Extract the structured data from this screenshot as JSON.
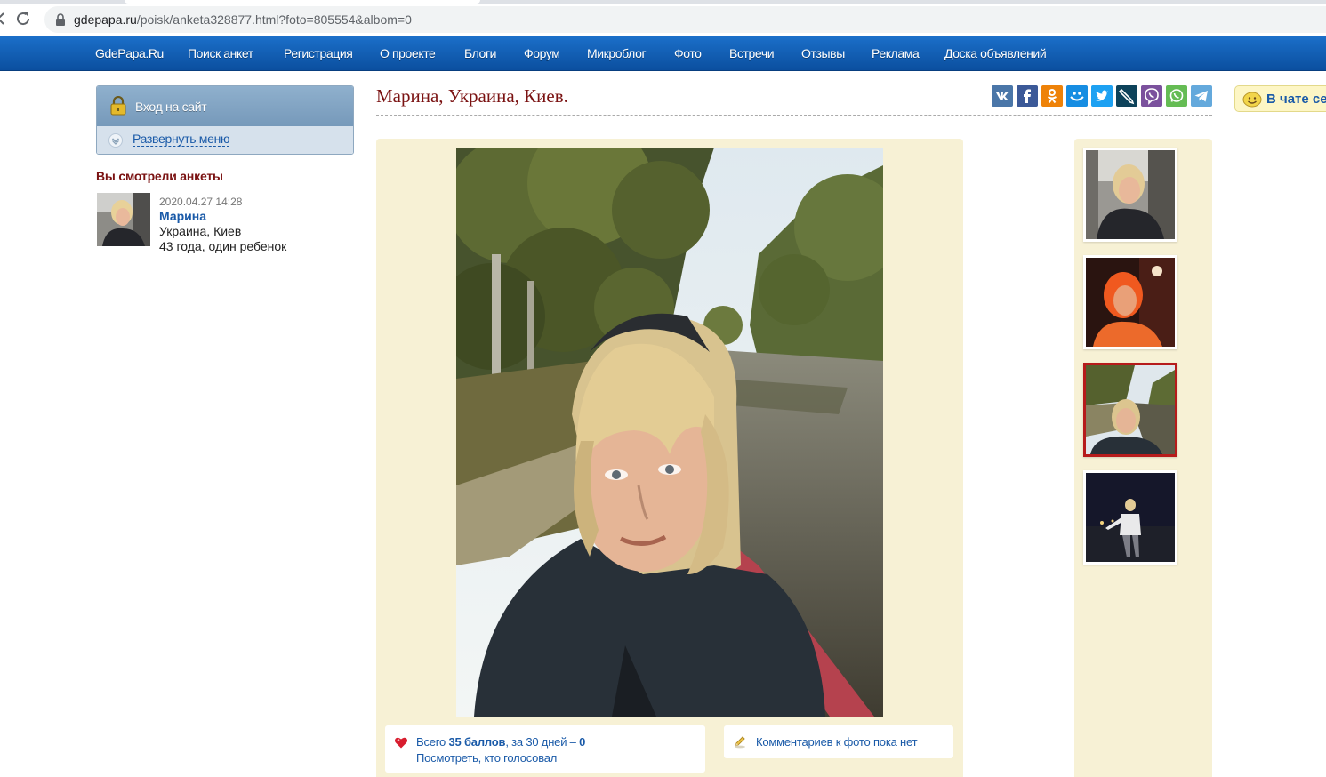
{
  "browser": {
    "url_host": "gdepapa.ru",
    "url_path": "/poisk/anketa328877.html?foto=805554&albom=0"
  },
  "nav": {
    "items": [
      "GdePapa.Ru",
      "Поиск анкет",
      "Регистрация",
      "О проекте",
      "Блоги",
      "Форум",
      "Микроблог",
      "Фото",
      "Встречи",
      "Отзывы",
      "Реклама",
      "Доска объявлений"
    ]
  },
  "sidebar": {
    "login_label": "Вход на сайт",
    "expand_menu": "Развернуть меню",
    "viewed_title": "Вы смотрели анкеты",
    "viewed": {
      "date": "2020.04.27 14:28",
      "name": "Марина",
      "location": "Украина, Киев",
      "details": "43 года, один ребенок"
    }
  },
  "profile": {
    "title": "Марина, Украина, Киев.",
    "chat_label": "В чате се"
  },
  "share_icons": [
    "vk-icon",
    "facebook-icon",
    "odnoklassniki-icon",
    "moimir-icon",
    "twitter-icon",
    "livejournal-icon",
    "viber-icon",
    "whatsapp-icon",
    "telegram-icon"
  ],
  "photo": {
    "votes_prefix": "Всего ",
    "votes_total": "35 баллов",
    "votes_mid": ", за 30 дней – ",
    "votes_month": "0",
    "who_voted": "Посмотреть, кто голосовал",
    "comments": "Комментариев к фото пока нет"
  },
  "colors": {
    "nav_blue": "#0b4f9f",
    "title_red": "#7a1212",
    "link_blue": "#1a5aa8",
    "panel_cream": "#f7f1d5",
    "active_border": "#b61b1b"
  }
}
